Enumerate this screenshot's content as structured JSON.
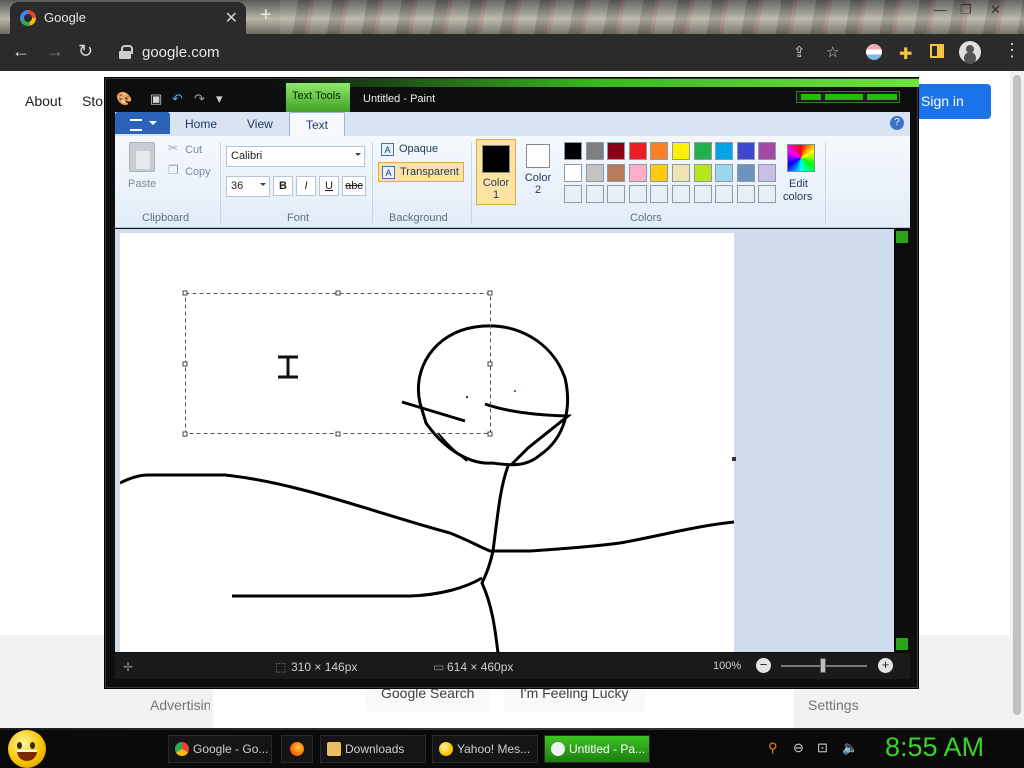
{
  "browser": {
    "tab_title": "Google",
    "tab_close": "✕",
    "new_tab": "+",
    "win_minimize": "—",
    "win_restore": "❐",
    "win_close": "✕",
    "back": "←",
    "forward": "→",
    "reload": "↻",
    "url": "google.com",
    "share": "⇪",
    "bookmark": "☆",
    "menu": "⋮"
  },
  "google": {
    "about": "About",
    "store": "Store",
    "sign_in": "Sign in",
    "advertising": "Advertising",
    "settings": "Settings",
    "search_button": "Google Search",
    "lucky_button": "I'm Feeling Lucky"
  },
  "paint": {
    "window_title": "Untitled - Paint",
    "context_tab": "Text Tools",
    "tabs": {
      "home": "Home",
      "view": "View",
      "text": "Text"
    },
    "help": "?",
    "clipboard": {
      "label": "Clipboard",
      "paste": "Paste",
      "cut": "Cut",
      "copy": "Copy"
    },
    "font": {
      "label": "Font",
      "family": "Calibri",
      "size": "36",
      "bold": "B",
      "italic": "I",
      "underline": "U",
      "strike": "abc"
    },
    "background": {
      "label": "Background",
      "opaque": "Opaque",
      "transparent": "Transparent",
      "selected": "Transparent"
    },
    "colors": {
      "label": "Colors",
      "color1_label": "Color",
      "color1_num": "1",
      "color2_label": "Color",
      "color2_num": "2",
      "edit_label": "Edit",
      "edit_label2": "colors",
      "color1": "#000000",
      "color2": "#ffffff",
      "palette": [
        [
          "#000000",
          "#7f7f7f",
          "#880015",
          "#ed1c24",
          "#ff7f27",
          "#fff200",
          "#22b14c",
          "#00a2e8",
          "#3f48cc",
          "#a349a4"
        ],
        [
          "#ffffff",
          "#c3c3c3",
          "#b97a57",
          "#ffaec9",
          "#ffc90e",
          "#efe4b0",
          "#b5e61d",
          "#99d9ea",
          "#7092be",
          "#c8bfe7"
        ],
        [
          "#e8eef6",
          "#e8eef6",
          "#e8eef6",
          "#e8eef6",
          "#e8eef6",
          "#e8eef6",
          "#e8eef6",
          "#e8eef6",
          "#e8eef6",
          "#e8eef6"
        ]
      ]
    },
    "status": {
      "selection_size": "310 × 146px",
      "canvas_size": "614 × 460px",
      "zoom": "100%",
      "zoom_out": "−",
      "zoom_in": "+"
    }
  },
  "taskbar": {
    "items": [
      {
        "label": "Google - Go..."
      },
      {
        "label": ""
      },
      {
        "label": "Downloads"
      },
      {
        "label": "Yahoo! Mes..."
      },
      {
        "label": "Untitled - Pa..."
      }
    ],
    "active": "Untitled - Pa...",
    "clock": "8:55 AM"
  }
}
